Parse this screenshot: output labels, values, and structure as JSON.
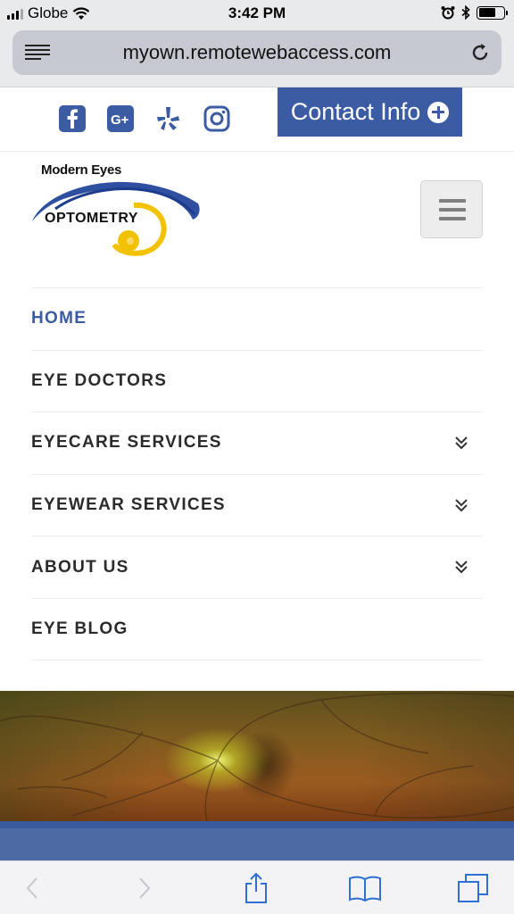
{
  "status": {
    "carrier": "Globe",
    "time": "3:42 PM"
  },
  "browser": {
    "url": "myown.remotewebaccess.com"
  },
  "header": {
    "contact_label": "Contact Info",
    "social": [
      "facebook-icon",
      "google-plus-icon",
      "yelp-icon",
      "instagram-icon"
    ],
    "logo_top": "Modern Eyes",
    "logo_main": "OPTOMETRY"
  },
  "nav": {
    "items": [
      {
        "label": "HOME",
        "active": true,
        "expandable": false
      },
      {
        "label": "EYE DOCTORS",
        "active": false,
        "expandable": false
      },
      {
        "label": "EYECARE SERVICES",
        "active": false,
        "expandable": true
      },
      {
        "label": "EYEWEAR SERVICES",
        "active": false,
        "expandable": true
      },
      {
        "label": "ABOUT US",
        "active": false,
        "expandable": true
      },
      {
        "label": "EYE BLOG",
        "active": false,
        "expandable": false
      }
    ]
  },
  "colors": {
    "brand_blue": "#3b5ca3",
    "logo_yellow": "#f2c200",
    "text_dark": "#2b2b2b"
  }
}
